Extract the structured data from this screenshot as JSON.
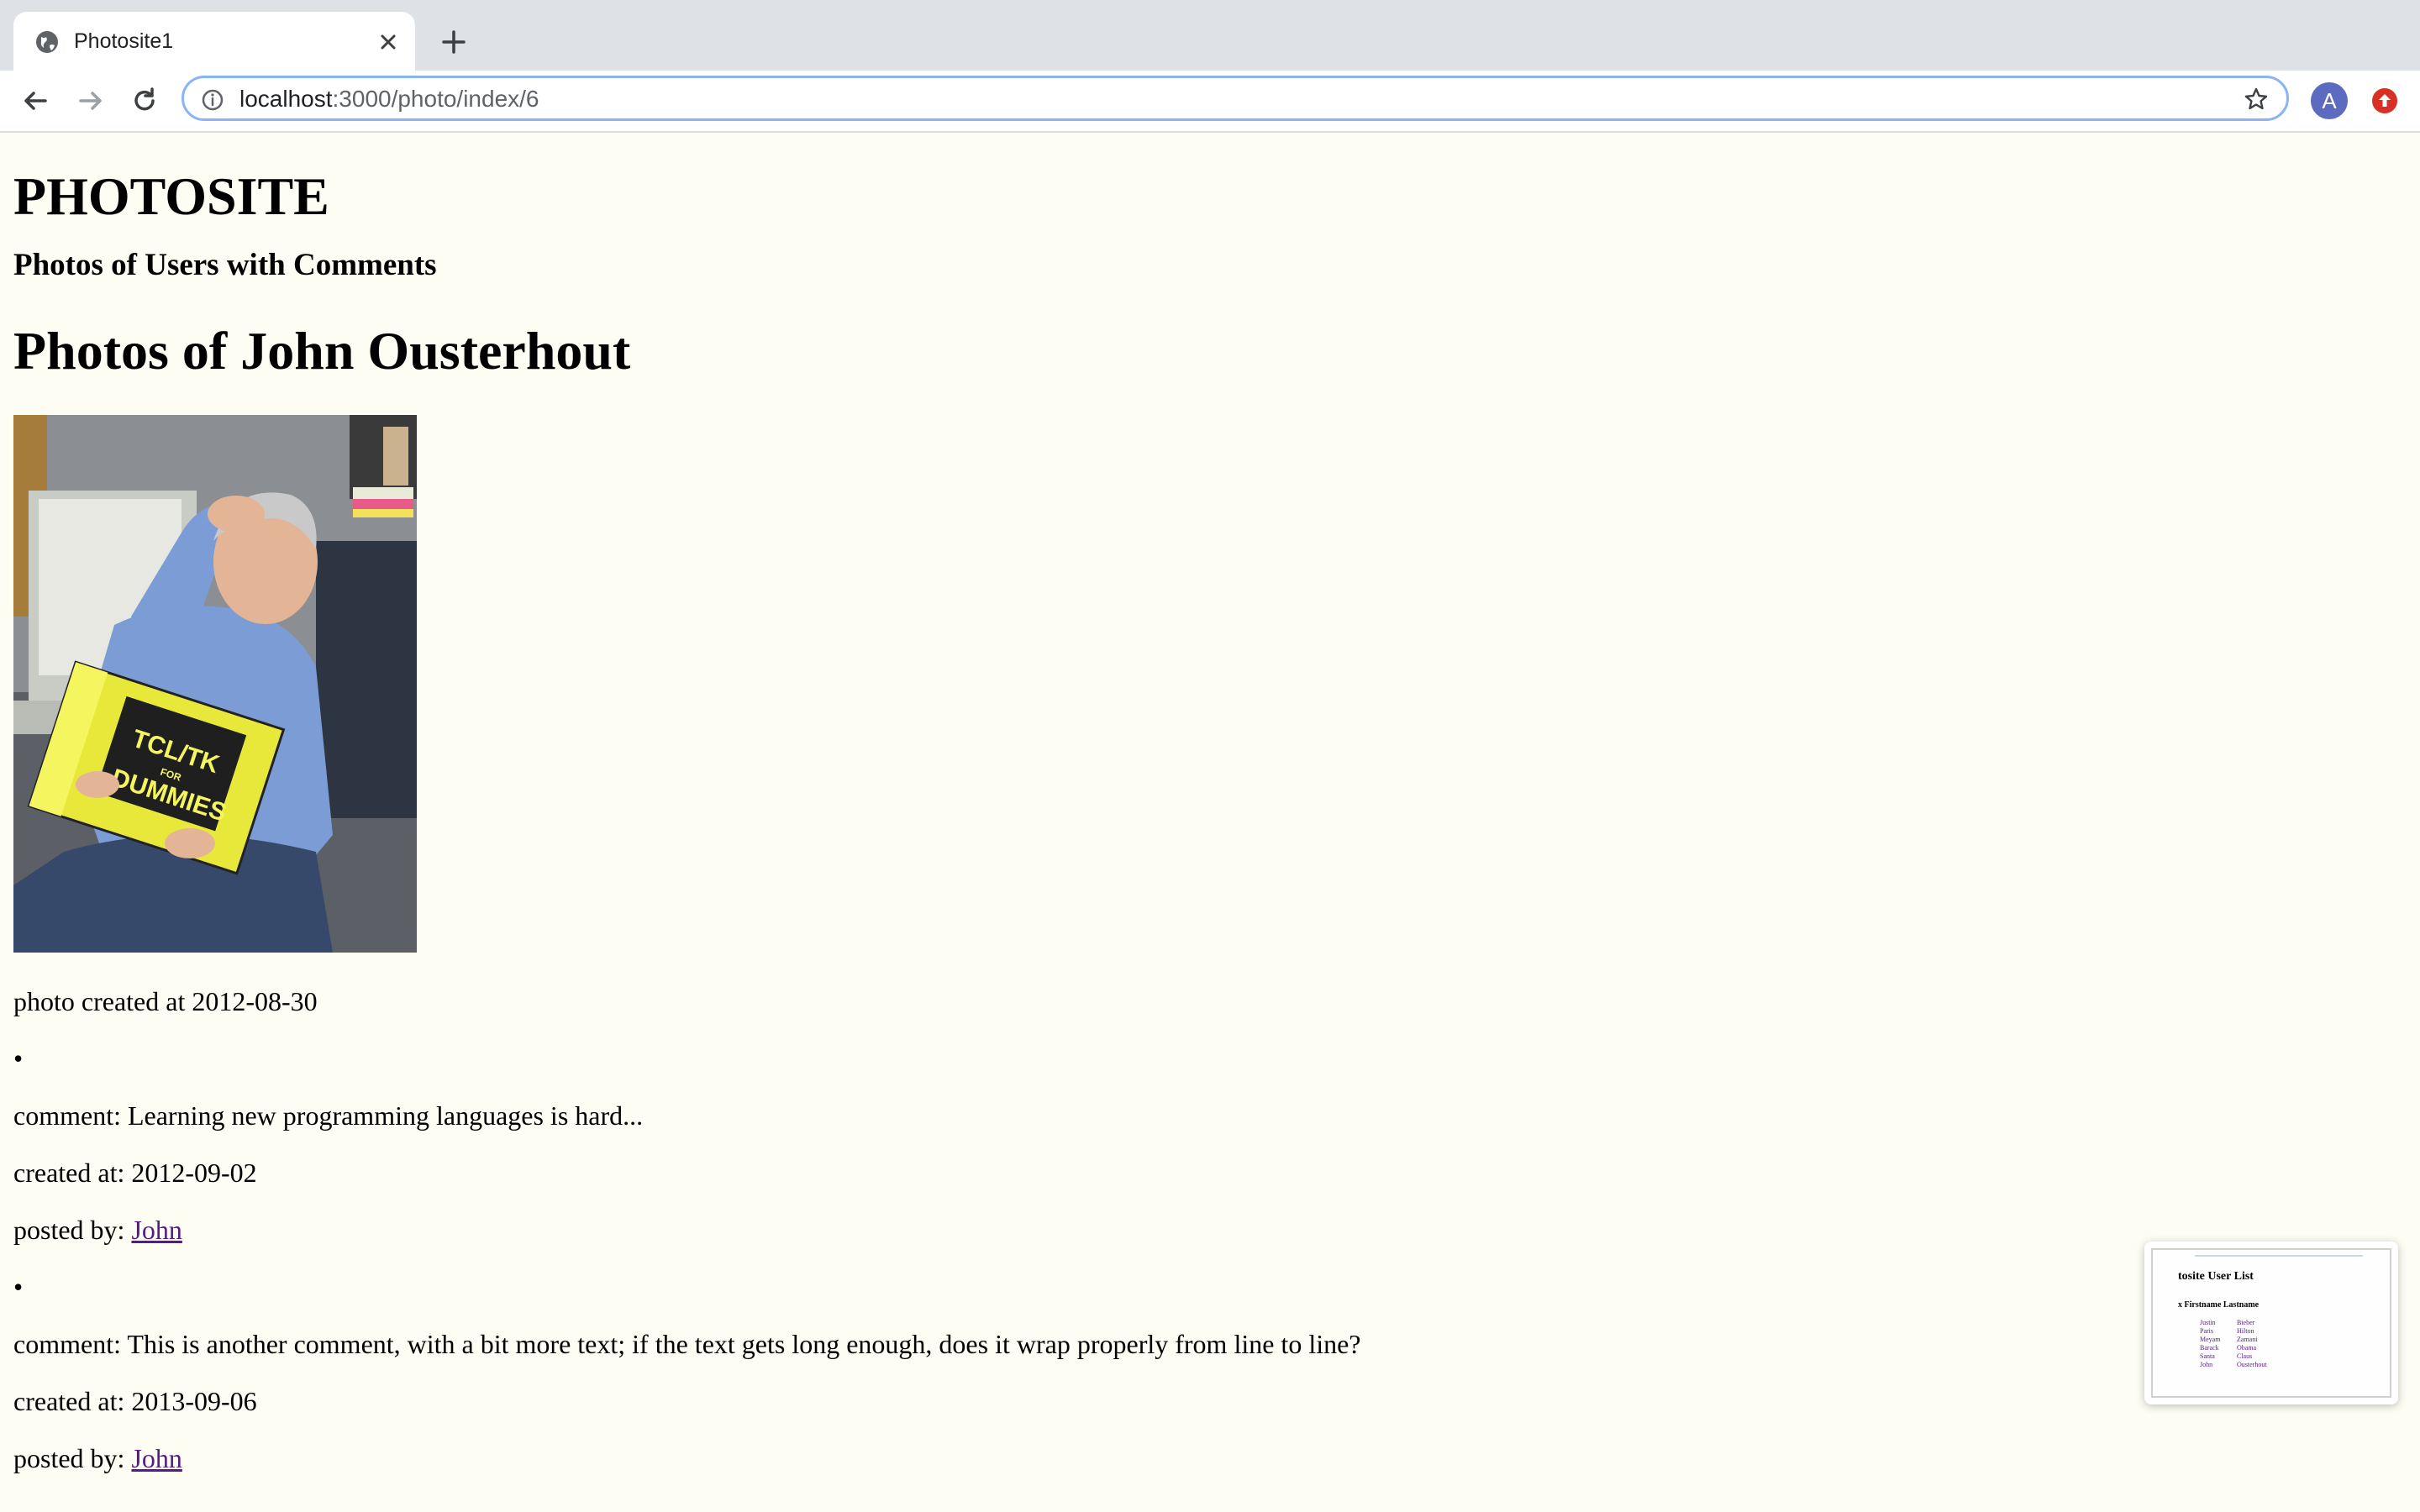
{
  "browser": {
    "tab_title": "Photosite1",
    "url_host": "localhost",
    "url_path": ":3000/photo/index/6",
    "avatar_letter": "A",
    "accent_color": "#8ab4f8"
  },
  "page": {
    "site_title": "PHOTOSITE",
    "subtitle": "Photos of Users with Comments",
    "user_heading": "Photos of John Ousterhout",
    "photo": {
      "alt": "John Ousterhout reading TCL/TK for Dummies",
      "book_title_line1": "TCL/TK",
      "book_title_line2": "FOR",
      "book_title_line3": "DUMMIES",
      "created_label": "photo created at 2012-08-30"
    },
    "comments": [
      {
        "bullet": "•",
        "comment": "comment: Learning new programming languages is hard...",
        "created": "created at: 2012-09-02",
        "posted_prefix": "posted by: ",
        "author": "John"
      },
      {
        "bullet": "•",
        "comment": "comment: This is another comment, with a bit more text; if the text gets long enough, does it wrap properly from line to line?",
        "created": "created at: 2013-09-06",
        "posted_prefix": "posted by: ",
        "author": "John"
      }
    ]
  },
  "thumbnail": {
    "title": "tosite User List",
    "header": "x Firstname Lastname",
    "first_names": [
      "Justin",
      "Paris",
      "Meyam",
      "Barack",
      "Santa",
      "John"
    ],
    "last_names": [
      "Bieber",
      "Hilton",
      "Zamani",
      "Obama",
      "Claus",
      "Ousterhout"
    ]
  }
}
